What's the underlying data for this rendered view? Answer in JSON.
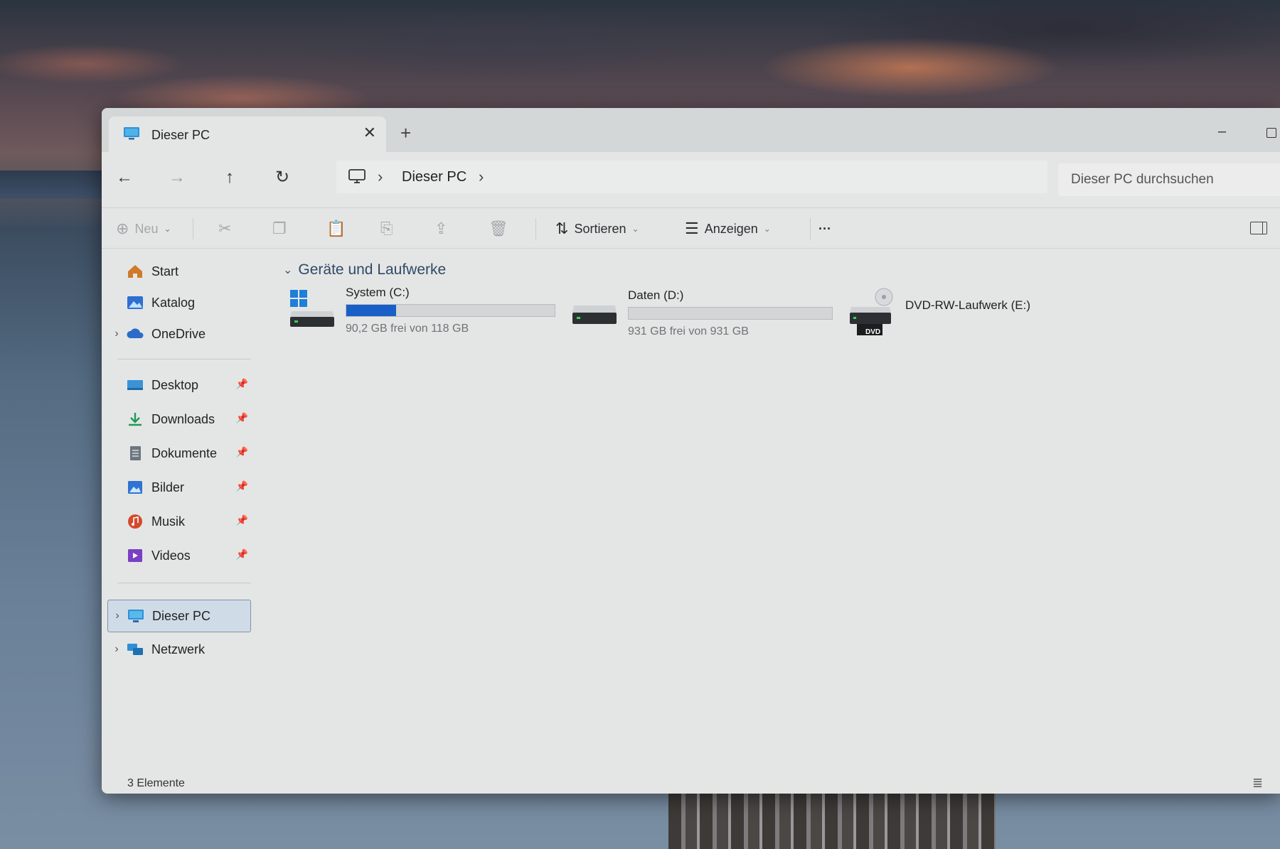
{
  "window": {
    "tab_title": "Dieser PC",
    "tab_close": "✕",
    "tab_new": "+",
    "minimize": "–"
  },
  "nav": {
    "back": "←",
    "forward": "→",
    "up": "↑",
    "refresh": "↻",
    "breadcrumb": [
      "Dieser PC"
    ],
    "separator": "›",
    "search_placeholder": "Dieser PC durchsuchen"
  },
  "commands": {
    "new_label": "Neu",
    "sort_label": "Sortieren",
    "view_label": "Anzeigen",
    "more_label": "···"
  },
  "sidebar": {
    "quick": [
      {
        "label": "Start",
        "icon": "home-icon",
        "color": "#d07a2b"
      },
      {
        "label": "Katalog",
        "icon": "gallery-icon",
        "color": "#2d6fd2"
      },
      {
        "label": "OneDrive",
        "icon": "cloud-icon",
        "color": "#2c6cc8",
        "expandable": true
      }
    ],
    "pinned": [
      {
        "label": "Desktop",
        "icon": "desktop-icon",
        "color": "#3a93d6"
      },
      {
        "label": "Downloads",
        "icon": "download-icon",
        "color": "#1f9a56"
      },
      {
        "label": "Dokumente",
        "icon": "document-icon",
        "color": "#6b7680"
      },
      {
        "label": "Bilder",
        "icon": "pictures-icon",
        "color": "#2f74d0"
      },
      {
        "label": "Musik",
        "icon": "music-icon",
        "color": "#d44a2c"
      },
      {
        "label": "Videos",
        "icon": "videos-icon",
        "color": "#7a3fc4"
      }
    ],
    "pin_glyph": "📌",
    "locations": [
      {
        "label": "Dieser PC",
        "icon": "pc-icon",
        "selected": true
      },
      {
        "label": "Netzwerk",
        "icon": "network-icon",
        "selected": false
      }
    ]
  },
  "content": {
    "group_title": "Geräte und Laufwerke",
    "drives": [
      {
        "name": "System (C:)",
        "free_text": "90,2 GB frei von 118 GB",
        "used_fraction": 0.24,
        "icon": "windows-drive-icon"
      },
      {
        "name": "Daten (D:)",
        "free_text": "931 GB frei von 931 GB",
        "used_fraction": 0.0,
        "icon": "hard-drive-icon"
      },
      {
        "name": "DVD-RW-Laufwerk (E:)",
        "icon": "dvd-drive-icon",
        "dvd_label": "DVD"
      }
    ]
  },
  "status": {
    "item_count": "3 Elemente",
    "view_glyph": "≣"
  },
  "colors": {
    "accent": "#1a5fc8",
    "window_bg": "#e4e6e5"
  }
}
